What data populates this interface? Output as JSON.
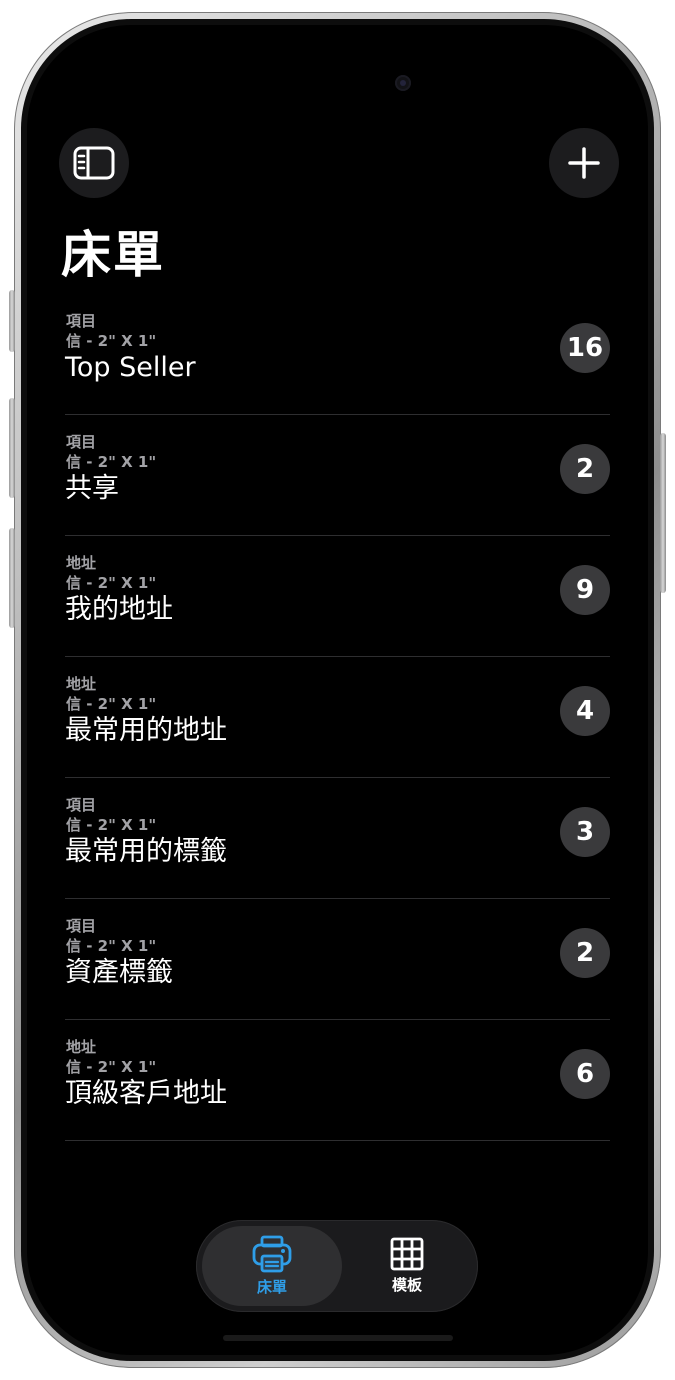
{
  "header": {
    "title": "床單",
    "sidebar_icon": "sidebar-toggle-icon",
    "add_icon": "plus-icon"
  },
  "list": {
    "items": [
      {
        "kind": "項目",
        "size": "信 - 2\" X 1\"",
        "name": "Top Seller",
        "count": "16"
      },
      {
        "kind": "項目",
        "size": "信 - 2\" X 1\"",
        "name": "共享",
        "count": "2"
      },
      {
        "kind": "地址",
        "size": "信 - 2\" X 1\"",
        "name": "我的地址",
        "count": "9"
      },
      {
        "kind": "地址",
        "size": "信 - 2\" X 1\"",
        "name": "最常用的地址",
        "count": "4"
      },
      {
        "kind": "項目",
        "size": "信 - 2\" X 1\"",
        "name": "最常用的標籤",
        "count": "3"
      },
      {
        "kind": "項目",
        "size": "信 - 2\" X 1\"",
        "name": "資產標籤",
        "count": "2"
      },
      {
        "kind": "地址",
        "size": "信 - 2\" X 1\"",
        "name": "頂級客戶地址",
        "count": "6"
      }
    ]
  },
  "tabbar": {
    "tabs": [
      {
        "label": "床單",
        "icon": "printer-icon",
        "active": true
      },
      {
        "label": "模板",
        "icon": "grid-icon",
        "active": false
      }
    ]
  },
  "colors": {
    "accent": "#2f9ee8",
    "background": "#000000",
    "badge": "#3a3a3c",
    "secondary_text": "#a2a2a6"
  }
}
